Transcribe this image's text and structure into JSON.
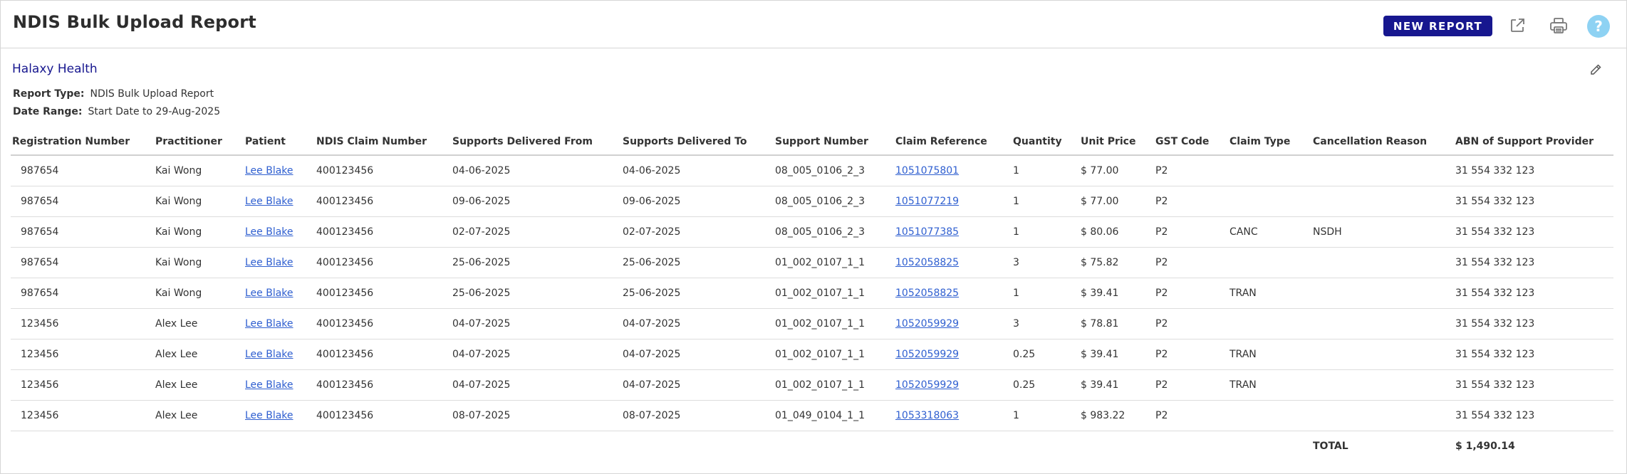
{
  "header": {
    "title": "NDIS Bulk Upload Report",
    "new_report_label": "NEW REPORT",
    "icons": [
      "external-link-icon",
      "printer-icon",
      "help-icon"
    ],
    "help_glyph": "?"
  },
  "report": {
    "org_name": "Halaxy Health",
    "report_type_label": "Report Type:",
    "report_type_value": "NDIS Bulk Upload Report",
    "date_range_label": "Date Range:",
    "date_range_value": "Start Date to 29-Aug-2025"
  },
  "colors": {
    "brand": "#17178f",
    "link": "#2f5fd0",
    "help": "#8ed2f3"
  },
  "table": {
    "columns": [
      "Registration Number",
      "Practitioner",
      "Patient",
      "NDIS Claim Number",
      "Supports Delivered From",
      "Supports Delivered To",
      "Support Number",
      "Claim Reference",
      "Quantity",
      "Unit Price",
      "GST Code",
      "Claim Type",
      "Cancellation Reason",
      "ABN of Support Provider"
    ],
    "rows": [
      [
        "987654",
        "Kai Wong",
        "Lee Blake",
        "400123456",
        "04-06-2025",
        "04-06-2025",
        "08_005_0106_2_3",
        "1051075801",
        "1",
        "$ 77.00",
        "P2",
        "",
        "",
        "31 554 332 123"
      ],
      [
        "987654",
        "Kai Wong",
        "Lee Blake",
        "400123456",
        "09-06-2025",
        "09-06-2025",
        "08_005_0106_2_3",
        "1051077219",
        "1",
        "$ 77.00",
        "P2",
        "",
        "",
        "31 554 332 123"
      ],
      [
        "987654",
        "Kai Wong",
        "Lee Blake",
        "400123456",
        "02-07-2025",
        "02-07-2025",
        "08_005_0106_2_3",
        "1051077385",
        "1",
        "$ 80.06",
        "P2",
        "CANC",
        "NSDH",
        "31 554 332 123"
      ],
      [
        "987654",
        "Kai Wong",
        "Lee Blake",
        "400123456",
        "25-06-2025",
        "25-06-2025",
        "01_002_0107_1_1",
        "1052058825",
        "3",
        "$ 75.82",
        "P2",
        "",
        "",
        "31 554 332 123"
      ],
      [
        "987654",
        "Kai Wong",
        "Lee Blake",
        "400123456",
        "25-06-2025",
        "25-06-2025",
        "01_002_0107_1_1",
        "1052058825",
        "1",
        "$ 39.41",
        "P2",
        "TRAN",
        "",
        "31 554 332 123"
      ],
      [
        "123456",
        "Alex Lee",
        "Lee Blake",
        "400123456",
        "04-07-2025",
        "04-07-2025",
        "01_002_0107_1_1",
        "1052059929",
        "3",
        "$ 78.81",
        "P2",
        "",
        "",
        "31 554 332 123"
      ],
      [
        "123456",
        "Alex Lee",
        "Lee Blake",
        "400123456",
        "04-07-2025",
        "04-07-2025",
        "01_002_0107_1_1",
        "1052059929",
        "0.25",
        "$ 39.41",
        "P2",
        "TRAN",
        "",
        "31 554 332 123"
      ],
      [
        "123456",
        "Alex Lee",
        "Lee Blake",
        "400123456",
        "04-07-2025",
        "04-07-2025",
        "01_002_0107_1_1",
        "1052059929",
        "0.25",
        "$ 39.41",
        "P2",
        "TRAN",
        "",
        "31 554 332 123"
      ],
      [
        "123456",
        "Alex Lee",
        "Lee Blake",
        "400123456",
        "08-07-2025",
        "08-07-2025",
        "01_049_0104_1_1",
        "1053318063",
        "1",
        "$ 983.22",
        "P2",
        "",
        "",
        "31 554 332 123"
      ]
    ],
    "total_label": "TOTAL",
    "total_value": "$ 1,490.14"
  }
}
